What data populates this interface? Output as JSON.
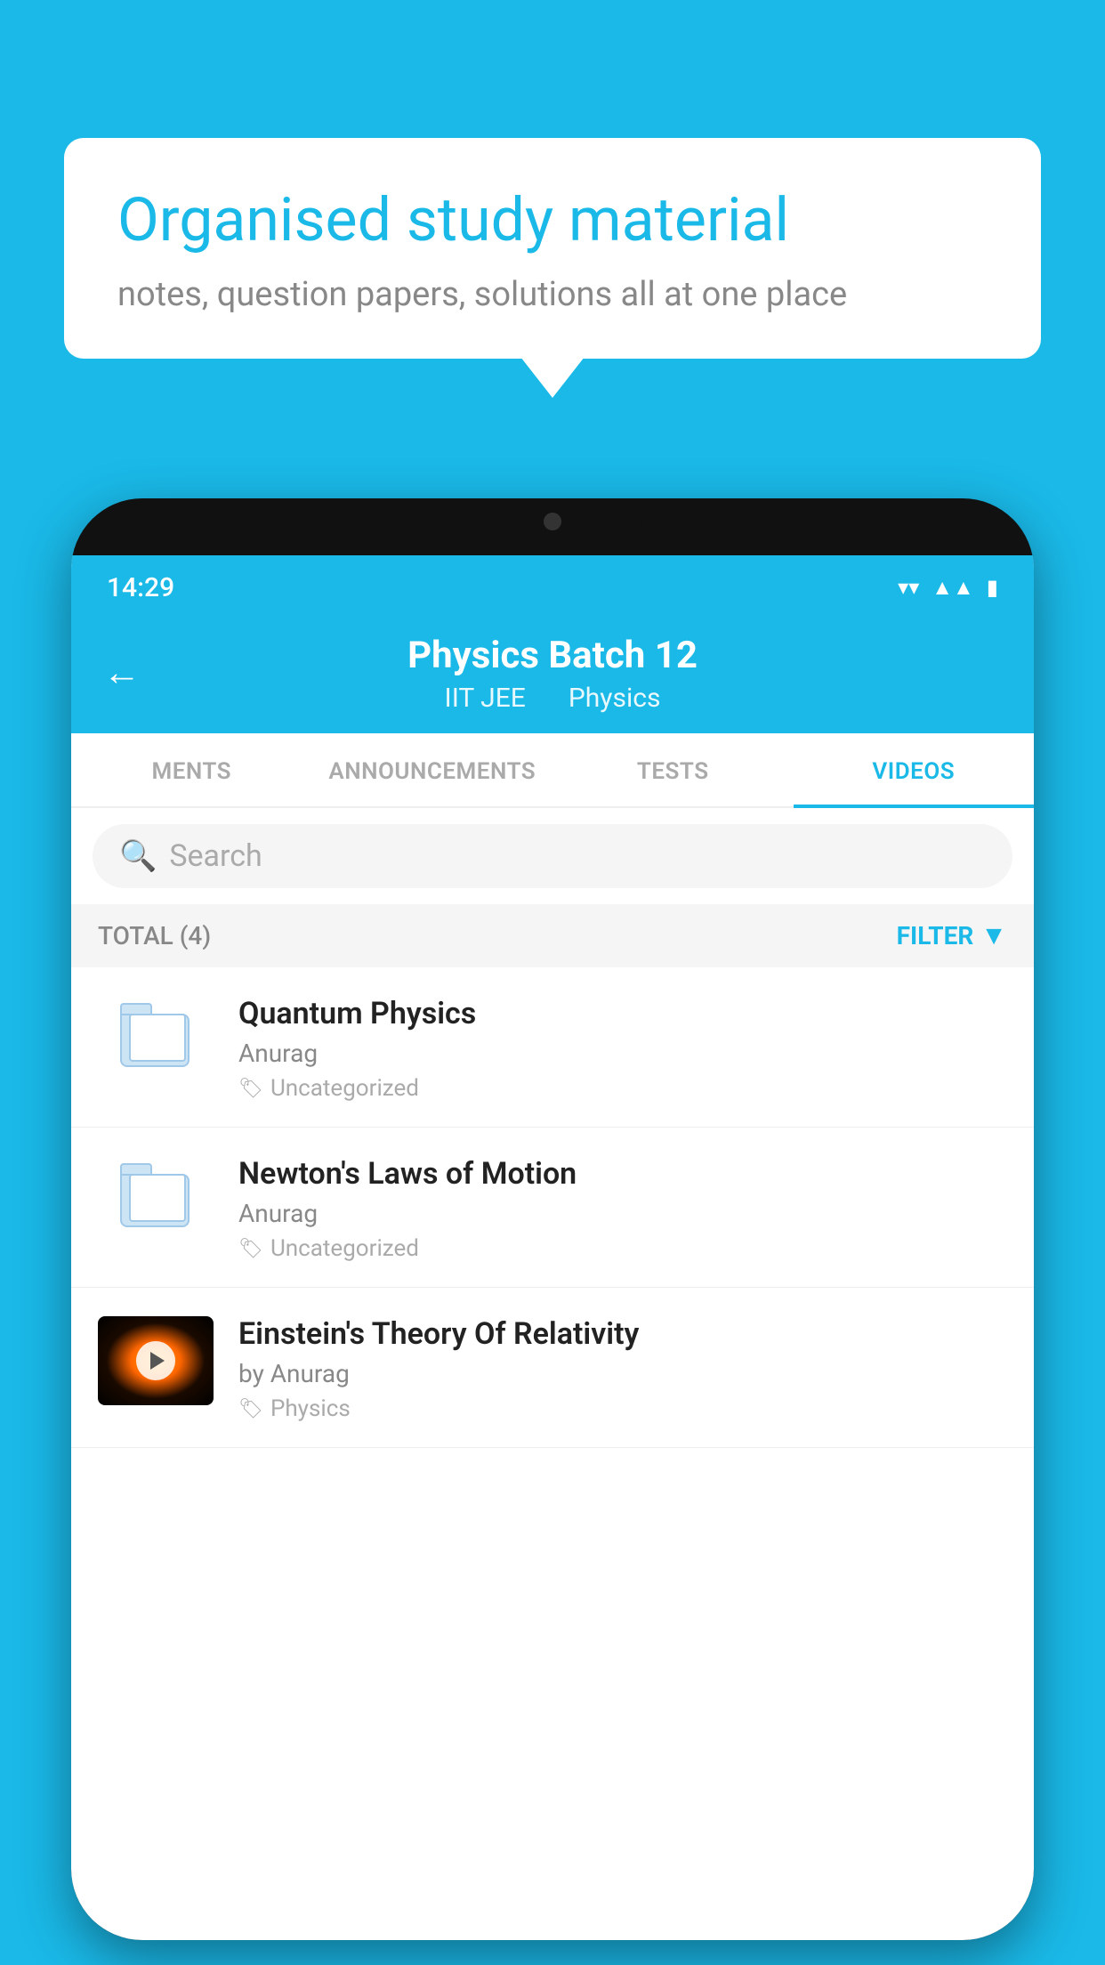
{
  "background": {
    "color": "#1ab9e8"
  },
  "speech_bubble": {
    "title": "Organised study material",
    "subtitle": "notes, question papers, solutions all at one place"
  },
  "phone": {
    "status_bar": {
      "time": "14:29"
    },
    "header": {
      "title": "Physics Batch 12",
      "subtitle1": "IIT JEE",
      "subtitle2": "Physics",
      "back_label": "←"
    },
    "tabs": [
      {
        "label": "MENTS",
        "active": false
      },
      {
        "label": "ANNOUNCEMENTS",
        "active": false
      },
      {
        "label": "TESTS",
        "active": false
      },
      {
        "label": "VIDEOS",
        "active": true
      }
    ],
    "search": {
      "placeholder": "Search"
    },
    "filter": {
      "total_label": "TOTAL (4)",
      "filter_label": "FILTER"
    },
    "videos": [
      {
        "title": "Quantum Physics",
        "author": "Anurag",
        "tag": "Uncategorized",
        "type": "folder",
        "has_thumb": false
      },
      {
        "title": "Newton's Laws of Motion",
        "author": "Anurag",
        "tag": "Uncategorized",
        "type": "folder",
        "has_thumb": false
      },
      {
        "title": "Einstein's Theory Of Relativity",
        "author": "by Anurag",
        "tag": "Physics",
        "type": "video",
        "has_thumb": true
      }
    ]
  }
}
